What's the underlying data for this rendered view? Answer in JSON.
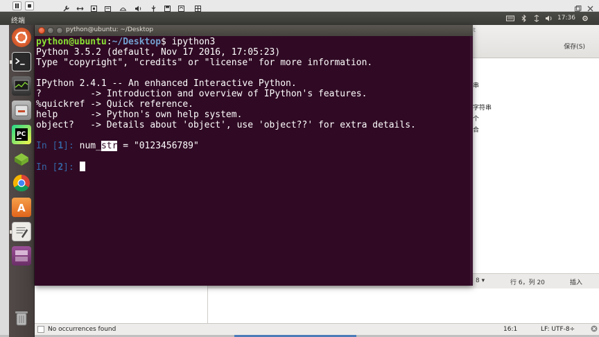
{
  "top_panel": {
    "title": "终端",
    "clock": "17:36"
  },
  "launcher": {
    "items": [
      {
        "name": "ubuntu-dash",
        "color": "#e95420"
      },
      {
        "name": "terminal",
        "color": "#2c2c2c"
      },
      {
        "name": "system-monitor",
        "color": "#3c3c3c"
      },
      {
        "name": "files",
        "color": "#7d7d7d"
      },
      {
        "name": "pycharm",
        "color": "#21d789"
      },
      {
        "name": "installer",
        "color": "#7fb33a"
      },
      {
        "name": "chrome",
        "color": "#db4437"
      },
      {
        "name": "software-center",
        "color": "#f08a24"
      },
      {
        "name": "text-editor",
        "color": "#e8e6e2"
      },
      {
        "name": "workspaces",
        "color": "#7a3c78"
      },
      {
        "name": "trash",
        "color": "#9a9a9a"
      }
    ]
  },
  "terminal": {
    "title": "python@ubuntu: ~/Desktop",
    "prompt_user": "python@ubuntu",
    "prompt_sep": ":",
    "prompt_path": "~/Desktop",
    "prompt_dollar": "$ ipython3",
    "lines": [
      "Python 3.5.2 (default, Nov 17 2016, 17:05:23)",
      "Type \"copyright\", \"credits\" or \"license\" for more information.",
      "",
      "IPython 2.4.1 -- An enhanced Interactive Python.",
      "?         -> Introduction and overview of IPython's features.",
      "%quickref -> Quick reference.",
      "help      -> Python's own help system.",
      "object?   -> Details about 'object', use 'object??' for extra details."
    ],
    "in1_label": "In [",
    "in1_num": "1",
    "in1_close": "]: ",
    "in1_code_pre": "num_",
    "in1_code_sel": "str",
    "in1_code_post": " = \"0123456789\"",
    "in2_label": "In [",
    "in2_num": "2",
    "in2_close": "]: "
  },
  "bg_window": {
    "title_fragment": "lt",
    "save_label": "保存(S)",
    "lines": [
      "串",
      "字符串",
      "个",
      "合"
    ],
    "status_tab": "8 ▾",
    "status_pos": "行 6，列 20",
    "status_insert": "插入"
  },
  "bottom_bar": {
    "message": "No occurrences found",
    "position": "16:1",
    "encoding": "LF: UTF-8÷"
  },
  "colors": {
    "terminal_bg": "#300a24",
    "prompt_green": "#8ae234",
    "prompt_blue": "#729fcf",
    "ipython_blue": "#3465a4"
  }
}
